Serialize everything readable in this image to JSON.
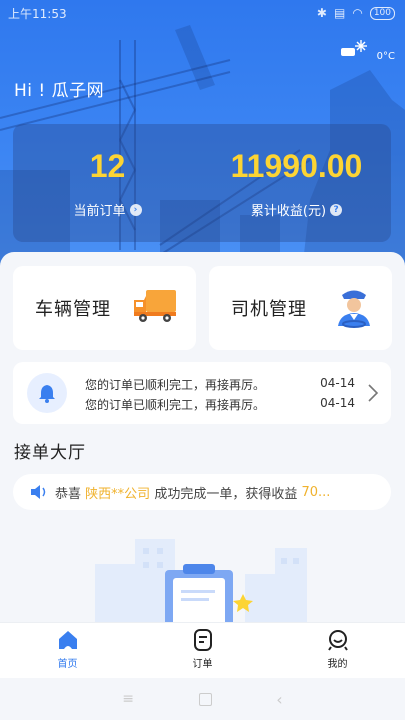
{
  "status_bar": {
    "time": "上午11:53",
    "battery": "100"
  },
  "weather": {
    "temperature": "0°C"
  },
  "greeting": "Hi ! 瓜子网",
  "stats": [
    {
      "value": "12",
      "label": "当前订单"
    },
    {
      "value": "11990.00",
      "label": "累计收益(元)"
    }
  ],
  "cards": [
    {
      "label": "车辆管理",
      "icon": "truck-icon"
    },
    {
      "label": "司机管理",
      "icon": "driver-icon"
    }
  ],
  "notices": [
    {
      "text": "您的订单已顺利完工，再接再厉。",
      "date": "04-14"
    },
    {
      "text": "您的订单已顺利完工，再接再厉。",
      "date": "04-14"
    }
  ],
  "section_title": "接单大厅",
  "ticker": {
    "prefix": "恭喜",
    "highlight": "陕西**公司",
    "middle": "成功完成一单，获得收益",
    "amount": "70..."
  },
  "tabs": [
    {
      "label": "首页",
      "icon": "home-icon",
      "active": true
    },
    {
      "label": "订单",
      "icon": "order-icon",
      "active": false
    },
    {
      "label": "我的",
      "icon": "profile-icon",
      "active": false
    }
  ],
  "colors": {
    "primary": "#2f78ee",
    "accent": "#fcd434",
    "highlight": "#f0b22d"
  }
}
